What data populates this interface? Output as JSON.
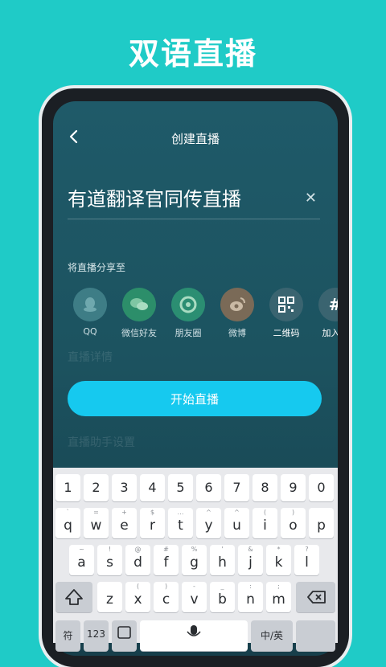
{
  "promo": {
    "title": "双语直播"
  },
  "nav": {
    "title": "创建直播"
  },
  "live": {
    "title_value": "有道翻译官同传直播",
    "share_label": "将直播分享至",
    "start_label": "开始直播",
    "faint_text_1": "直播详情",
    "faint_text_2": "直播助手设置"
  },
  "share": [
    {
      "label": "QQ",
      "icon": "qq-icon",
      "color": "#3e7d86"
    },
    {
      "label": "微信好友",
      "icon": "wechat-icon",
      "color": "#2c8e6a"
    },
    {
      "label": "朋友圈",
      "icon": "moments-icon",
      "color": "#2b8e72"
    },
    {
      "label": "微博",
      "icon": "weibo-icon",
      "color": "#7a6a57"
    },
    {
      "label": "二维码",
      "icon": "qrcode-icon",
      "color": "#3a6470"
    },
    {
      "label": "加入码",
      "icon": "hash-icon",
      "color": "#3a6470"
    }
  ],
  "keyboard": {
    "row1": [
      "1",
      "2",
      "3",
      "4",
      "5",
      "6",
      "7",
      "8",
      "9",
      "0"
    ],
    "row2": [
      "q",
      "w",
      "e",
      "r",
      "t",
      "y",
      "u",
      "i",
      "o",
      "p"
    ],
    "row2_sub": [
      "`",
      "=",
      "+",
      "$",
      "…",
      "^",
      "^",
      "(",
      ")",
      ""
    ],
    "row3": [
      "a",
      "s",
      "d",
      "f",
      "g",
      "h",
      "j",
      "k",
      "l"
    ],
    "row3_sub": [
      "~",
      "!",
      "@",
      "#",
      "%",
      "'",
      "&",
      "*",
      "?"
    ],
    "row4": [
      "z",
      "x",
      "c",
      "v",
      "b",
      "n",
      "m"
    ],
    "row4_sub": [
      "",
      "(",
      ")",
      "-",
      "_",
      ":",
      ";"
    ],
    "symbol_key": "符",
    "num_key": "123",
    "lang_key": "中/英",
    "shift_icon": "shift-icon",
    "backspace_icon": "backspace-icon",
    "mic_icon": "mic-icon"
  }
}
